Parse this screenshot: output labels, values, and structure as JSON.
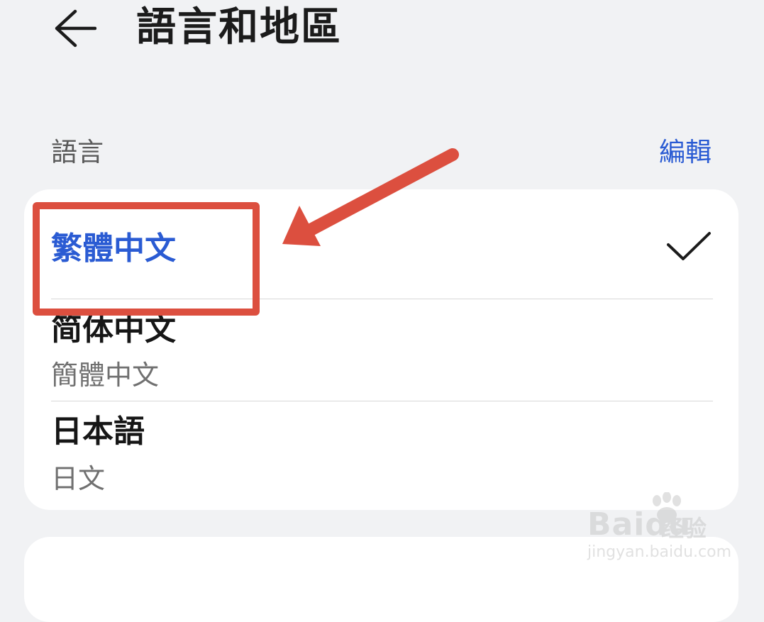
{
  "header": {
    "back_icon": "arrow-left-icon",
    "title": "語言和地區"
  },
  "language_section": {
    "label": "語言",
    "edit_label": "編輯",
    "items": [
      {
        "title": "繁體中文",
        "subtitle": "",
        "selected": true
      },
      {
        "title": "简体中文",
        "subtitle": "簡體中文",
        "selected": false
      },
      {
        "title": "日本語",
        "subtitle": "日文",
        "selected": false
      }
    ]
  },
  "colors": {
    "accent": "#2a5bd3",
    "background": "#f1f2f4",
    "card": "#ffffff",
    "annotation": "#dc4f3f"
  },
  "watermark": {
    "logo": "Baidu",
    "logo_cn": "经验",
    "url": "jingyan.baidu.com"
  }
}
